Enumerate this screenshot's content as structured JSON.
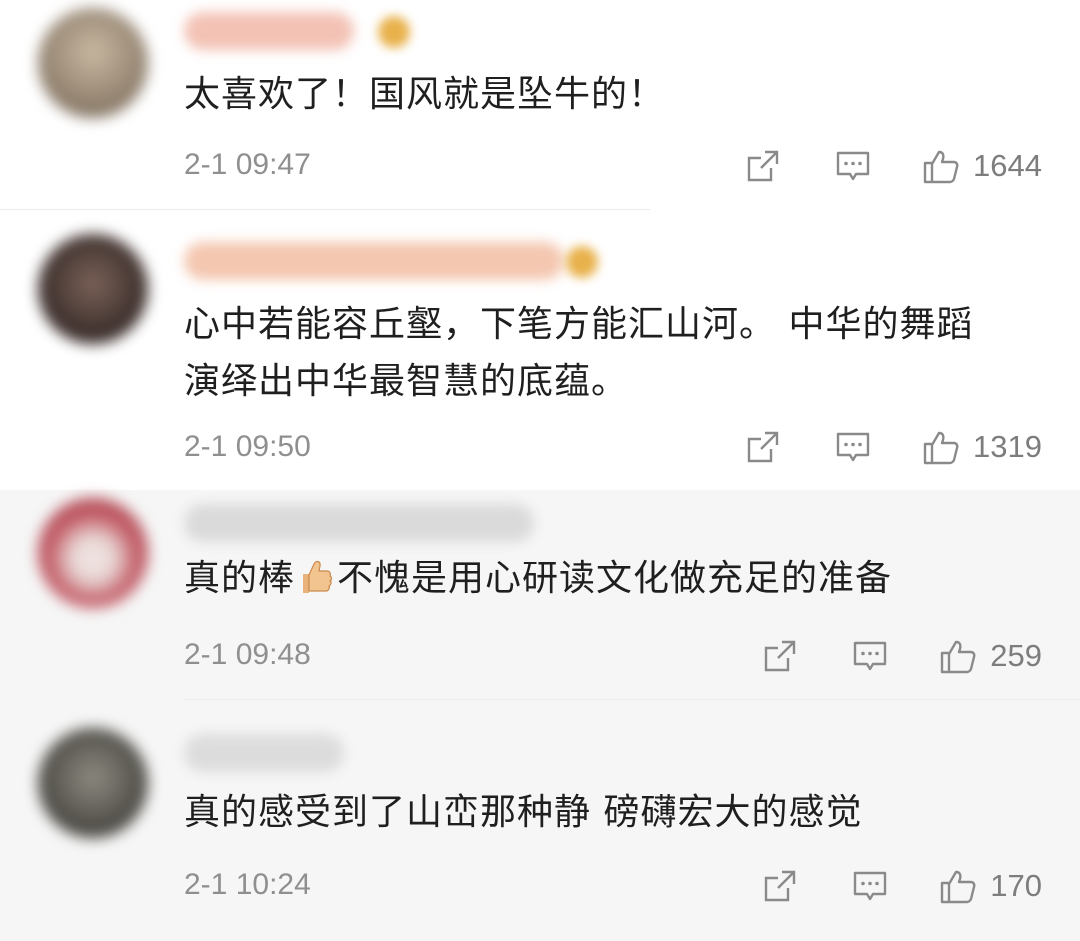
{
  "comments": [
    {
      "text": "太喜欢了！国风就是坠牛的！",
      "time": "2-1 09:47",
      "likes": "1644",
      "name_color": "#f3c2b5",
      "avatar_color": "#8a7a68"
    },
    {
      "text_line1": "心中若能容丘壑，下笔方能汇山河。 中华的舞蹈",
      "text_line2": "演绎出中华最智慧的底蕴。",
      "time": "2-1 09:50",
      "likes": "1319",
      "name_color": "#f4c7b0",
      "avatar_color": "#4a3a35"
    },
    {
      "text_before": "真的棒",
      "emoji": "thumbs-up-emoji",
      "text_after": "不愧是用心研读文化做充足的准备",
      "time": "2-1 09:48",
      "likes": "259",
      "name_color": "#d8d8d8",
      "avatar_color": "#b84a55"
    },
    {
      "text": "真的感受到了山峦那种静 磅礴宏大的感觉",
      "time": "2-1 10:24",
      "likes": "170",
      "name_color": "#dcdcdc",
      "avatar_color": "#4d4b45"
    }
  ],
  "icons": {
    "share": "share-icon",
    "comment": "comment-icon",
    "like": "thumbs-up-icon"
  }
}
